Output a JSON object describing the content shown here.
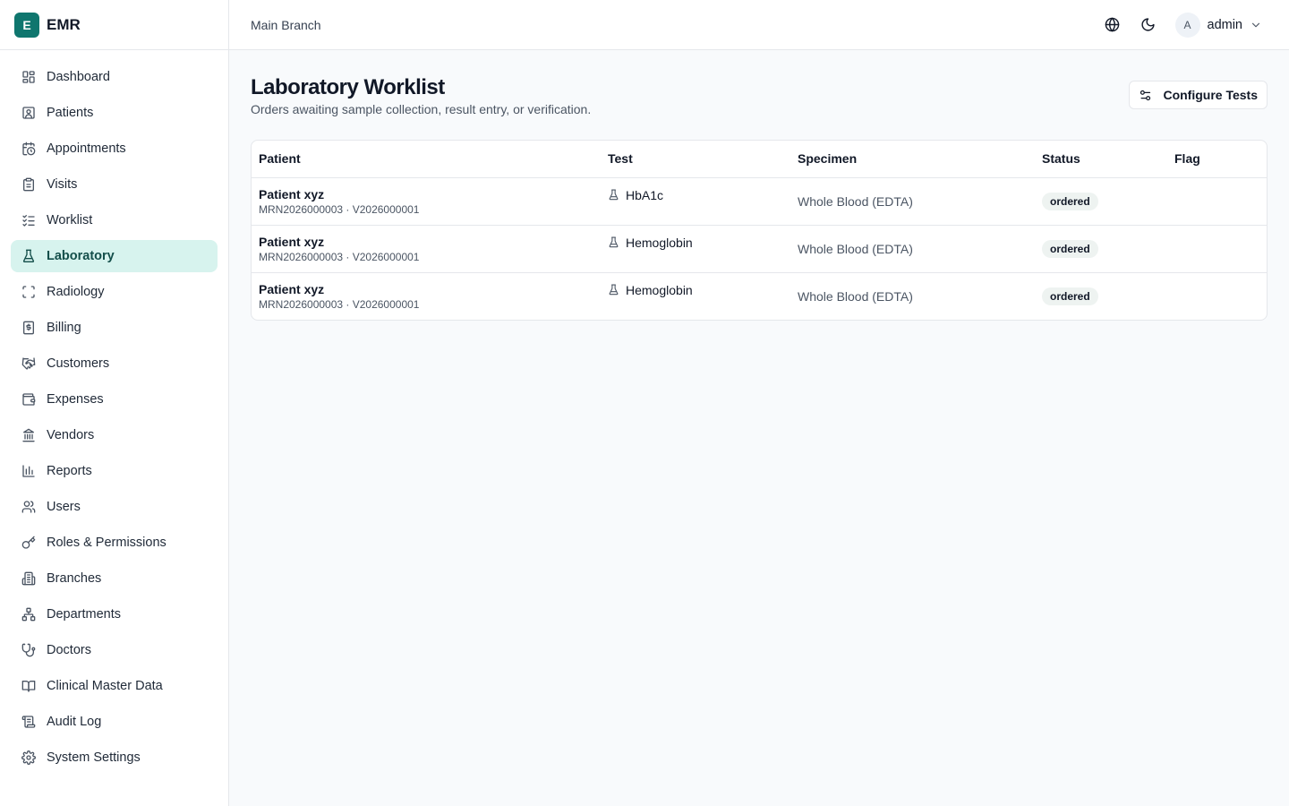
{
  "brand": {
    "logo_letter": "E",
    "name": "EMR",
    "accent": "#0f766e"
  },
  "sidebar": {
    "items": [
      {
        "label": "Dashboard",
        "icon": "dashboard-icon"
      },
      {
        "label": "Patients",
        "icon": "patient-icon"
      },
      {
        "label": "Appointments",
        "icon": "calendar-clock-icon"
      },
      {
        "label": "Visits",
        "icon": "clipboard-icon"
      },
      {
        "label": "Worklist",
        "icon": "checklist-icon"
      },
      {
        "label": "Laboratory",
        "icon": "flask-icon",
        "active": true
      },
      {
        "label": "Radiology",
        "icon": "scan-icon"
      },
      {
        "label": "Billing",
        "icon": "receipt-icon"
      },
      {
        "label": "Customers",
        "icon": "handshake-icon"
      },
      {
        "label": "Expenses",
        "icon": "wallet-icon"
      },
      {
        "label": "Vendors",
        "icon": "bank-icon"
      },
      {
        "label": "Reports",
        "icon": "bar-chart-icon"
      },
      {
        "label": "Users",
        "icon": "users-icon"
      },
      {
        "label": "Roles & Permissions",
        "icon": "key-icon"
      },
      {
        "label": "Branches",
        "icon": "building-icon"
      },
      {
        "label": "Departments",
        "icon": "org-chart-icon"
      },
      {
        "label": "Doctors",
        "icon": "stethoscope-icon"
      },
      {
        "label": "Clinical Master Data",
        "icon": "book-icon"
      },
      {
        "label": "Audit Log",
        "icon": "scroll-icon"
      },
      {
        "label": "System Settings",
        "icon": "gear-icon"
      }
    ]
  },
  "topbar": {
    "branch": "Main Branch",
    "user": {
      "initial": "A",
      "name": "admin"
    }
  },
  "page": {
    "title": "Laboratory Worklist",
    "subtitle": "Orders awaiting sample collection, result entry, or verification.",
    "configure_label": "Configure Tests"
  },
  "table": {
    "columns": [
      "Patient",
      "Test",
      "Specimen",
      "Status",
      "Flag"
    ],
    "rows": [
      {
        "patient": "Patient xyz",
        "meta": "MRN2026000003 · V2026000001",
        "test": "HbA1c",
        "specimen": "Whole Blood (EDTA)",
        "status": "ordered",
        "flag": ""
      },
      {
        "patient": "Patient xyz",
        "meta": "MRN2026000003 · V2026000001",
        "test": "Hemoglobin",
        "specimen": "Whole Blood (EDTA)",
        "status": "ordered",
        "flag": ""
      },
      {
        "patient": "Patient xyz",
        "meta": "MRN2026000003 · V2026000001",
        "test": "Hemoglobin",
        "specimen": "Whole Blood (EDTA)",
        "status": "ordered",
        "flag": ""
      }
    ]
  }
}
